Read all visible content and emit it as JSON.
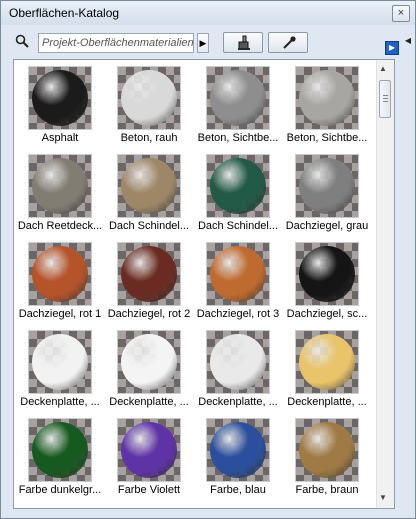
{
  "window": {
    "title": "Oberflächen-Katalog",
    "close_label": "×"
  },
  "toolbar": {
    "search_placeholder": "Projekt-Oberflächenmaterialien",
    "search_arrow": "▶",
    "side_arrow": "▶",
    "collapse_arrow": "◀"
  },
  "scrollbar": {
    "up": "▲",
    "down": "▼",
    "position": 0.05
  },
  "materials": [
    {
      "label": "Asphalt",
      "color": "#1b1b1b"
    },
    {
      "label": "Beton, rauh",
      "color": "#d9d9d9"
    },
    {
      "label": "Beton, Sichtbe...",
      "color": "#8e8e8e"
    },
    {
      "label": "Beton, Sichtbe...",
      "color": "#a7a6a2"
    },
    {
      "label": "Dach Reetdeck...",
      "color": "#827d73"
    },
    {
      "label": "Dach Schindel...",
      "color": "#9e8767"
    },
    {
      "label": "Dach Schindel...",
      "color": "#225a47"
    },
    {
      "label": "Dachziegel, grau",
      "color": "#7f7f7f"
    },
    {
      "label": "Dachziegel, rot 1",
      "color": "#b5532a"
    },
    {
      "label": "Dachziegel, rot 2",
      "color": "#6a2c22"
    },
    {
      "label": "Dachziegel, rot 3",
      "color": "#bf6a30"
    },
    {
      "label": "Dachziegel, sc...",
      "color": "#151515"
    },
    {
      "label": "Deckenplatte, ...",
      "color": "#f2f2f2"
    },
    {
      "label": "Deckenplatte, ...",
      "color": "#f4f4f4"
    },
    {
      "label": "Deckenplatte, ...",
      "color": "#e9e9e9"
    },
    {
      "label": "Deckenplatte, ...",
      "color": "#e9c46b"
    },
    {
      "label": "Farbe dunkelgr...",
      "color": "#175a20"
    },
    {
      "label": "Farbe Violett",
      "color": "#5e33a6"
    },
    {
      "label": "Farbe, blau",
      "color": "#2b4f9c"
    },
    {
      "label": "Farbe, braun",
      "color": "#a07a44"
    }
  ]
}
